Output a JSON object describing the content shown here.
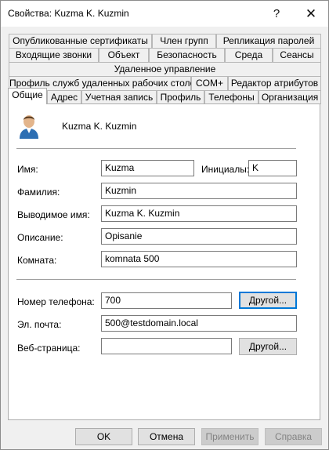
{
  "window": {
    "title": "Свойства: Kuzma K. Kuzmin",
    "help_glyph": "?",
    "close_glyph": "✕"
  },
  "tabs": {
    "row1": [
      "Опубликованные сертификаты",
      "Член групп",
      "Репликация паролей"
    ],
    "row2": [
      "Входящие звонки",
      "Объект",
      "Безопасность",
      "Среда",
      "Сеансы"
    ],
    "row3": [
      "Удаленное управление"
    ],
    "row4": [
      "Профиль служб удаленных рабочих столов",
      "COM+",
      "Редактор атрибутов"
    ],
    "row5": [
      "Общие",
      "Адрес",
      "Учетная запись",
      "Профиль",
      "Телефоны",
      "Организация"
    ],
    "active": "Общие"
  },
  "general": {
    "display_name_header": "Kuzma K. Kuzmin",
    "first_name_label": "Имя:",
    "first_name_value": "Kuzma",
    "initials_label": "Инициалы:",
    "initials_value": "K",
    "last_name_label": "Фамилия:",
    "last_name_value": "Kuzmin",
    "display_name_label": "Выводимое имя:",
    "display_name_value": "Kuzma K. Kuzmin",
    "description_label": "Описание:",
    "description_value": "Opisanie",
    "office_label": "Комната:",
    "office_value": "komnata 500",
    "phone_label": "Номер телефона:",
    "phone_value": "700",
    "phone_other_button": "Другой...",
    "email_label": "Эл. почта:",
    "email_value": "500@testdomain.local",
    "webpage_label": "Веб-страница:",
    "webpage_value": "",
    "webpage_other_button": "Другой..."
  },
  "buttons": {
    "ok": "OK",
    "cancel": "Отмена",
    "apply": "Применить",
    "help": "Справка"
  },
  "colors": {
    "accent": "#0078d7",
    "dialog_bg": "#f0f0f0",
    "panel_bg": "#ffffff"
  }
}
